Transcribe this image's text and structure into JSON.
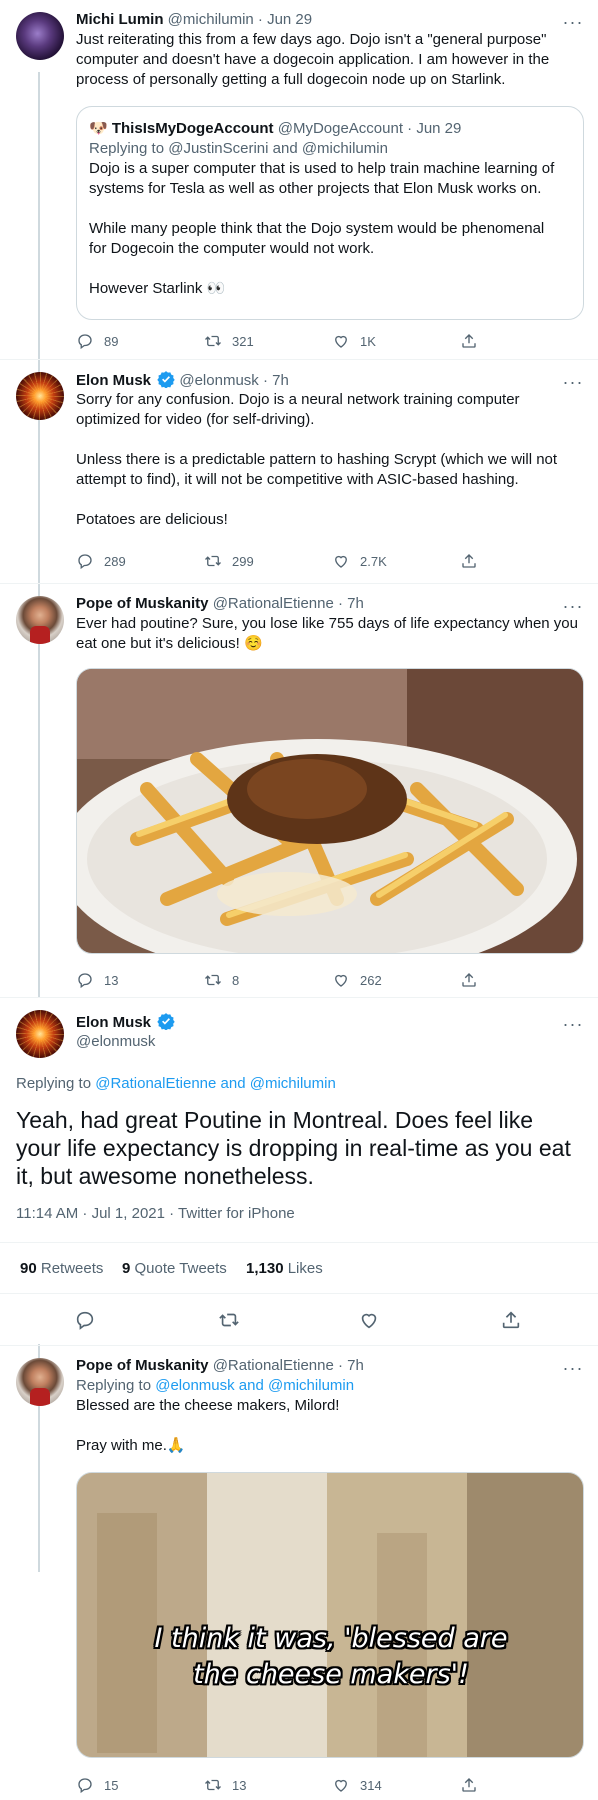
{
  "tweets": [
    {
      "name": "Michi Lumin",
      "handle": "@michilumin",
      "time": "· Jun 29",
      "lines": [
        "Just reiterating this from a few days ago.  Dojo isn't a \"general purpose\"",
        "computer and doesn't have a dogecoin application.  I am however in the",
        "process of personally getting a full dogecoin node up on Starlink."
      ],
      "quote": {
        "emoji": "🐶",
        "name": "ThisIsMyDogeAccount",
        "handle": "@MyDogeAccount",
        "time": "· Jun 29",
        "replying": "Replying to @JustinScerini and @michilumin",
        "para1": [
          "Dojo is a super computer that is used to help train machine learning of",
          "systems for Tesla as well as other projects that Elon Musk works on."
        ],
        "para2": [
          "While many people think that the Dojo system would be phenomenal",
          "for Dogecoin the computer would not work."
        ],
        "para3": "However Starlink 👀"
      },
      "replies": "89",
      "retweets": "321",
      "likes": "1K"
    },
    {
      "name": "Elon Musk",
      "handle": "@elonmusk",
      "time": "· 7h",
      "para1": [
        "Sorry for any confusion. Dojo is a neural network training computer",
        "optimized for video (for self-driving)."
      ],
      "para2": [
        "Unless there is a predictable pattern to hashing Scrypt (which we will not",
        "attempt to find), it will not be competitive with ASIC-based hashing."
      ],
      "para3": "Potatoes are delicious!",
      "replies": "289",
      "retweets": "299",
      "likes": "2.7K"
    },
    {
      "name": "Pope of Muskanity",
      "handle": "@RationalEtienne",
      "time": "· 7h",
      "lines": [
        "Ever had poutine? Sure, you lose like 755 days of life expectancy when you",
        "eat one but it's delicious! ☺️"
      ],
      "replies": "13",
      "retweets": "8",
      "likes": "262"
    }
  ],
  "focus": {
    "name": "Elon Musk",
    "handle": "@elonmusk",
    "replying_prefix": "Replying to",
    "replying_users": "@RationalEtienne and @michilumin",
    "text": "Yeah, had great Poutine in Montreal. Does feel like your life expectancy is dropping in real-time as you eat it, but awesome nonetheless.",
    "meta": "11:14 AM · Jul 1, 2021 · Twitter for iPhone",
    "retweets_count": "90",
    "retweets_label": "Retweets",
    "quotes_count": "9",
    "quotes_label": "Quote Tweets",
    "likes_count": "1,130",
    "likes_label": "Likes"
  },
  "reply": {
    "name": "Pope of Muskanity",
    "handle": "@RationalEtienne",
    "time": "· 7h",
    "replying_prefix": "Replying to",
    "replying_users": "@elonmusk and @michilumin",
    "line1": "Blessed are the cheese makers, Milord!",
    "line2": "Pray with me.🙏",
    "gif_caption_1": "I think it was, 'blessed are",
    "gif_caption_2": "the cheese makers'!",
    "replies": "15",
    "retweets": "13",
    "likes": "314"
  },
  "icons": {
    "reply": "reply-icon",
    "retweet": "retweet-icon",
    "like": "heart-icon",
    "share": "share-icon",
    "verified": "verified-badge-icon",
    "more": "more-icon"
  },
  "colors": {
    "accent": "#1d9bf0",
    "text": "#0f1419",
    "muted": "#536471",
    "border": "#cfd9de"
  }
}
